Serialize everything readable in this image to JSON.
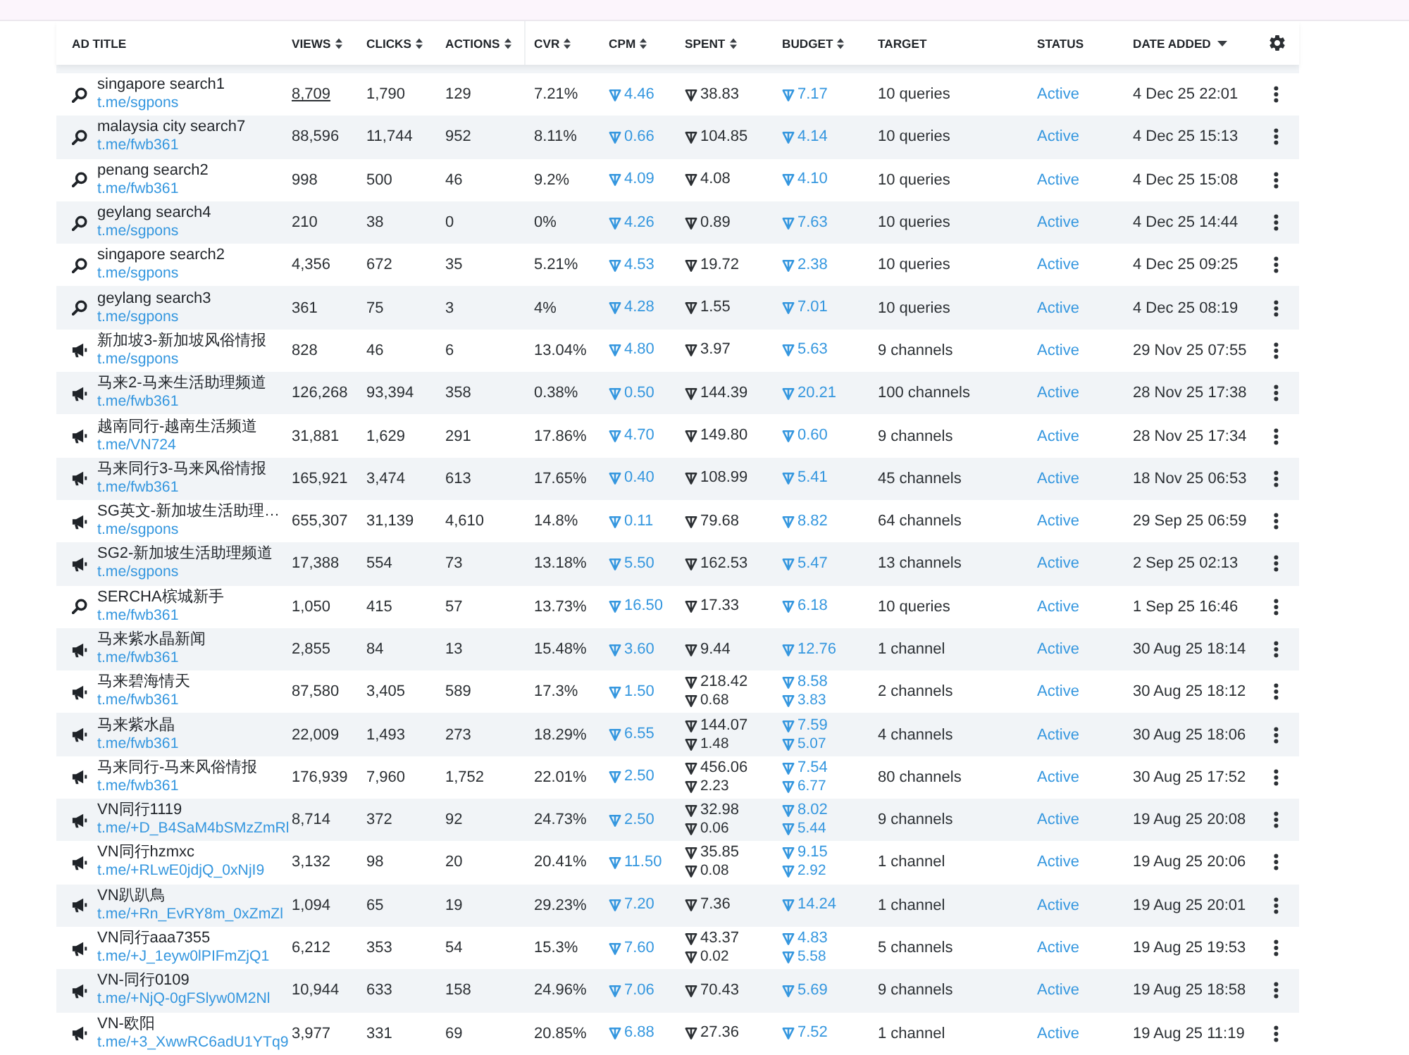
{
  "table": {
    "columns": [
      {
        "label": "AD TITLE",
        "sortable": false,
        "sorted": false
      },
      {
        "label": "VIEWS",
        "sortable": true,
        "sorted": false
      },
      {
        "label": "CLICKS",
        "sortable": true,
        "sorted": false
      },
      {
        "label": "ACTIONS",
        "sortable": true,
        "sorted": false
      },
      {
        "label": "CVR",
        "sortable": true,
        "sorted": false
      },
      {
        "label": "CPM",
        "sortable": true,
        "sorted": false
      },
      {
        "label": "SPENT",
        "sortable": true,
        "sorted": false
      },
      {
        "label": "BUDGET",
        "sortable": true,
        "sorted": false
      },
      {
        "label": "TARGET",
        "sortable": false,
        "sorted": false
      },
      {
        "label": "STATUS",
        "sortable": false,
        "sorted": false
      },
      {
        "label": "DATE ADDED",
        "sortable": true,
        "sorted": true
      }
    ],
    "rows": [
      {
        "kind": "search",
        "title": "singapore search1",
        "link": "t.me/sgpons",
        "views": "8,709",
        "views_hovered": true,
        "clicks": "1,790",
        "actions": "129",
        "cvr": "7.21%",
        "cpm": "4.46",
        "spent": [
          "38.83"
        ],
        "budget": [
          "7.17"
        ],
        "target": "10 queries",
        "status": "Active",
        "date": "4 Dec 25 22:01"
      },
      {
        "kind": "search",
        "title": "malaysia city search7",
        "link": "t.me/fwb361",
        "views": "88,596",
        "views_hovered": false,
        "clicks": "11,744",
        "actions": "952",
        "cvr": "8.11%",
        "cpm": "0.66",
        "spent": [
          "104.85"
        ],
        "budget": [
          "4.14"
        ],
        "target": "10 queries",
        "status": "Active",
        "date": "4 Dec 25 15:13"
      },
      {
        "kind": "search",
        "title": "penang search2",
        "link": "t.me/fwb361",
        "views": "998",
        "views_hovered": false,
        "clicks": "500",
        "actions": "46",
        "cvr": "9.2%",
        "cpm": "4.09",
        "spent": [
          "4.08"
        ],
        "budget": [
          "4.10"
        ],
        "target": "10 queries",
        "status": "Active",
        "date": "4 Dec 25 15:08"
      },
      {
        "kind": "search",
        "title": "geylang search4",
        "link": "t.me/sgpons",
        "views": "210",
        "views_hovered": false,
        "clicks": "38",
        "actions": "0",
        "cvr": "0%",
        "cpm": "4.26",
        "spent": [
          "0.89"
        ],
        "budget": [
          "7.63"
        ],
        "target": "10 queries",
        "status": "Active",
        "date": "4 Dec 25 14:44"
      },
      {
        "kind": "search",
        "title": "singapore search2",
        "link": "t.me/sgpons",
        "views": "4,356",
        "views_hovered": false,
        "clicks": "672",
        "actions": "35",
        "cvr": "5.21%",
        "cpm": "4.53",
        "spent": [
          "19.72"
        ],
        "budget": [
          "2.38"
        ],
        "target": "10 queries",
        "status": "Active",
        "date": "4 Dec 25 09:25"
      },
      {
        "kind": "search",
        "title": "geylang search3",
        "link": "t.me/sgpons",
        "views": "361",
        "views_hovered": false,
        "clicks": "75",
        "actions": "3",
        "cvr": "4%",
        "cpm": "4.28",
        "spent": [
          "1.55"
        ],
        "budget": [
          "7.01"
        ],
        "target": "10 queries",
        "status": "Active",
        "date": "4 Dec 25 08:19"
      },
      {
        "kind": "channel",
        "title": "新加坡3-新加坡风俗情报",
        "link": "t.me/sgpons",
        "views": "828",
        "views_hovered": false,
        "clicks": "46",
        "actions": "6",
        "cvr": "13.04%",
        "cpm": "4.80",
        "spent": [
          "3.97"
        ],
        "budget": [
          "5.63"
        ],
        "target": "9 channels",
        "status": "Active",
        "date": "29 Nov 25 07:55"
      },
      {
        "kind": "channel",
        "title": "马来2-马来生活助理频道",
        "link": "t.me/fwb361",
        "views": "126,268",
        "views_hovered": false,
        "clicks": "93,394",
        "actions": "358",
        "cvr": "0.38%",
        "cpm": "0.50",
        "spent": [
          "144.39"
        ],
        "budget": [
          "20.21"
        ],
        "target": "100 channels",
        "status": "Active",
        "date": "28 Nov 25 17:38"
      },
      {
        "kind": "channel",
        "title": "越南同行-越南生活频道",
        "link": "t.me/VN724",
        "views": "31,881",
        "views_hovered": false,
        "clicks": "1,629",
        "actions": "291",
        "cvr": "17.86%",
        "cpm": "4.70",
        "spent": [
          "149.80"
        ],
        "budget": [
          "0.60"
        ],
        "target": "9 channels",
        "status": "Active",
        "date": "28 Nov 25 17:34"
      },
      {
        "kind": "channel",
        "title": "马来同行3-马来风俗情报",
        "link": "t.me/fwb361",
        "views": "165,921",
        "views_hovered": false,
        "clicks": "3,474",
        "actions": "613",
        "cvr": "17.65%",
        "cpm": "0.40",
        "spent": [
          "108.99"
        ],
        "budget": [
          "5.41"
        ],
        "target": "45 channels",
        "status": "Active",
        "date": "18 Nov 25 06:53"
      },
      {
        "kind": "channel",
        "title": "SG英文-新加坡生活助理…",
        "link": "t.me/sgpons",
        "views": "655,307",
        "views_hovered": false,
        "clicks": "31,139",
        "actions": "4,610",
        "cvr": "14.8%",
        "cpm": "0.11",
        "spent": [
          "79.68"
        ],
        "budget": [
          "8.82"
        ],
        "target": "64 channels",
        "status": "Active",
        "date": "29 Sep 25 06:59"
      },
      {
        "kind": "channel",
        "title": "SG2-新加坡生活助理频道",
        "link": "t.me/sgpons",
        "views": "17,388",
        "views_hovered": false,
        "clicks": "554",
        "actions": "73",
        "cvr": "13.18%",
        "cpm": "5.50",
        "spent": [
          "162.53"
        ],
        "budget": [
          "5.47"
        ],
        "target": "13 channels",
        "status": "Active",
        "date": "2 Sep 25 02:13"
      },
      {
        "kind": "search",
        "title": "SERCHA槟城新手",
        "link": "t.me/fwb361",
        "views": "1,050",
        "views_hovered": false,
        "clicks": "415",
        "actions": "57",
        "cvr": "13.73%",
        "cpm": "16.50",
        "spent": [
          "17.33"
        ],
        "budget": [
          "6.18"
        ],
        "target": "10 queries",
        "status": "Active",
        "date": "1 Sep 25 16:46"
      },
      {
        "kind": "channel",
        "title": "马来紫水晶新闻",
        "link": "t.me/fwb361",
        "views": "2,855",
        "views_hovered": false,
        "clicks": "84",
        "actions": "13",
        "cvr": "15.48%",
        "cpm": "3.60",
        "spent": [
          "9.44"
        ],
        "budget": [
          "12.76"
        ],
        "target": "1 channel",
        "status": "Active",
        "date": "30 Aug 25 18:14"
      },
      {
        "kind": "channel",
        "title": "马来碧海情天",
        "link": "t.me/fwb361",
        "views": "87,580",
        "views_hovered": false,
        "clicks": "3,405",
        "actions": "589",
        "cvr": "17.3%",
        "cpm": "1.50",
        "spent": [
          "218.42",
          "0.68"
        ],
        "budget": [
          "8.58",
          "3.83"
        ],
        "target": "2 channels",
        "status": "Active",
        "date": "30 Aug 25 18:12"
      },
      {
        "kind": "channel",
        "title": "马来紫水晶",
        "link": "t.me/fwb361",
        "views": "22,009",
        "views_hovered": false,
        "clicks": "1,493",
        "actions": "273",
        "cvr": "18.29%",
        "cpm": "6.55",
        "spent": [
          "144.07",
          "1.48"
        ],
        "budget": [
          "7.59",
          "5.07"
        ],
        "target": "4 channels",
        "status": "Active",
        "date": "30 Aug 25 18:06"
      },
      {
        "kind": "channel",
        "title": "马来同行-马来风俗情报",
        "link": "t.me/fwb361",
        "views": "176,939",
        "views_hovered": false,
        "clicks": "7,960",
        "actions": "1,752",
        "cvr": "22.01%",
        "cpm": "2.50",
        "spent": [
          "456.06",
          "2.23"
        ],
        "budget": [
          "7.54",
          "6.77"
        ],
        "target": "80 channels",
        "status": "Active",
        "date": "30 Aug 25 17:52"
      },
      {
        "kind": "channel",
        "title": "VN同行1119",
        "link": "t.me/+D_B4SaM4bSMzZmRl",
        "views": "8,714",
        "views_hovered": false,
        "clicks": "372",
        "actions": "92",
        "cvr": "24.73%",
        "cpm": "2.50",
        "spent": [
          "32.98",
          "0.06"
        ],
        "budget": [
          "8.02",
          "5.44"
        ],
        "target": "9 channels",
        "status": "Active",
        "date": "19 Aug 25 20:08"
      },
      {
        "kind": "channel",
        "title": "VN同行hzmxc",
        "link": "t.me/+RLwE0jdjQ_0xNjI9",
        "views": "3,132",
        "views_hovered": false,
        "clicks": "98",
        "actions": "20",
        "cvr": "20.41%",
        "cpm": "11.50",
        "spent": [
          "35.85",
          "0.08"
        ],
        "budget": [
          "9.15",
          "2.92"
        ],
        "target": "1 channel",
        "status": "Active",
        "date": "19 Aug 25 20:06"
      },
      {
        "kind": "channel",
        "title": "VN趴趴鳥",
        "link": "t.me/+Rn_EvRY8m_0xZmZl",
        "views": "1,094",
        "views_hovered": false,
        "clicks": "65",
        "actions": "19",
        "cvr": "29.23%",
        "cpm": "7.20",
        "spent": [
          "7.36"
        ],
        "budget": [
          "14.24"
        ],
        "target": "1 channel",
        "status": "Active",
        "date": "19 Aug 25 20:01"
      },
      {
        "kind": "channel",
        "title": "VN同行aaa7355",
        "link": "t.me/+J_1eyw0lPIFmZjQ1",
        "views": "6,212",
        "views_hovered": false,
        "clicks": "353",
        "actions": "54",
        "cvr": "15.3%",
        "cpm": "7.60",
        "spent": [
          "43.37",
          "0.02"
        ],
        "budget": [
          "4.83",
          "5.58"
        ],
        "target": "5 channels",
        "status": "Active",
        "date": "19 Aug 25 19:53"
      },
      {
        "kind": "channel",
        "title": "VN-同行0109",
        "link": "t.me/+NjQ-0gFSlyw0M2Nl",
        "views": "10,944",
        "views_hovered": false,
        "clicks": "633",
        "actions": "158",
        "cvr": "24.96%",
        "cpm": "7.06",
        "spent": [
          "70.43"
        ],
        "budget": [
          "5.69"
        ],
        "target": "9 channels",
        "status": "Active",
        "date": "19 Aug 25 18:58"
      },
      {
        "kind": "channel",
        "title": "VN-欧阳",
        "link": "t.me/+3_XwwRC6adU1YTq9",
        "views": "3,977",
        "views_hovered": false,
        "clicks": "331",
        "actions": "69",
        "cvr": "20.85%",
        "cpm": "6.88",
        "spent": [
          "27.36"
        ],
        "budget": [
          "7.52"
        ],
        "target": "1 channel",
        "status": "Active",
        "date": "19 Aug 25 11:19"
      }
    ]
  }
}
